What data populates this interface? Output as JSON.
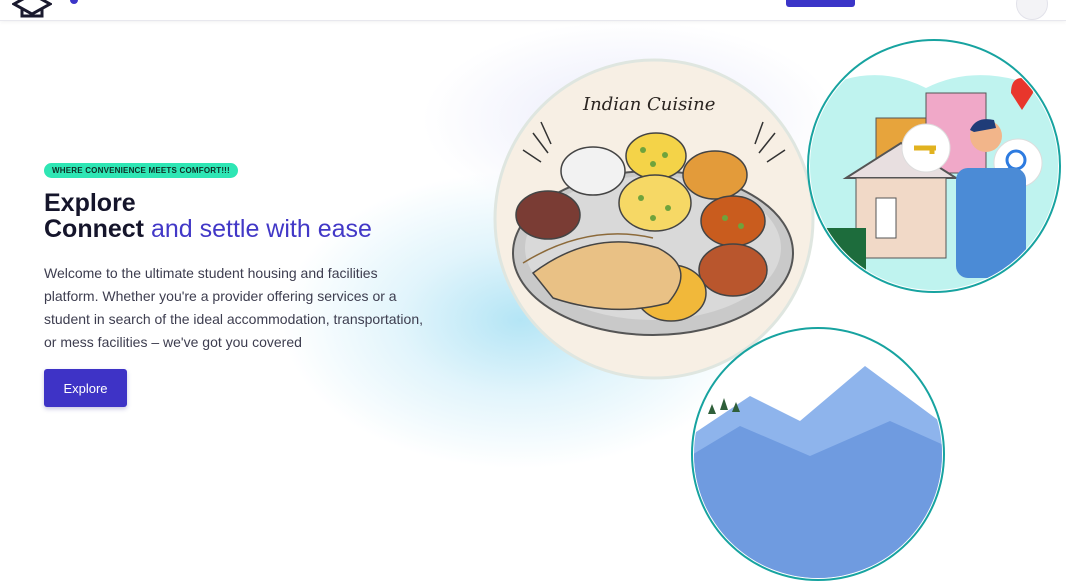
{
  "hero": {
    "badge": "WHERE CONVENIENCE MEETS COMFORT!!!",
    "title_line1": "Explore",
    "title_line2_plain": "Connect",
    "title_line2_accent": "and settle with ease",
    "description": "Welcome to the ultimate student housing and facilities platform. Whether you're a provider offering services or a student in search of the ideal accommodation, transportation, or mess facilities – we've got you covered",
    "cta_label": "Explore"
  },
  "images": {
    "food_caption": "Indian Cuisine"
  },
  "colors": {
    "accent": "#3e33c6",
    "badge": "#2ee6b4",
    "title": "#15152b"
  }
}
